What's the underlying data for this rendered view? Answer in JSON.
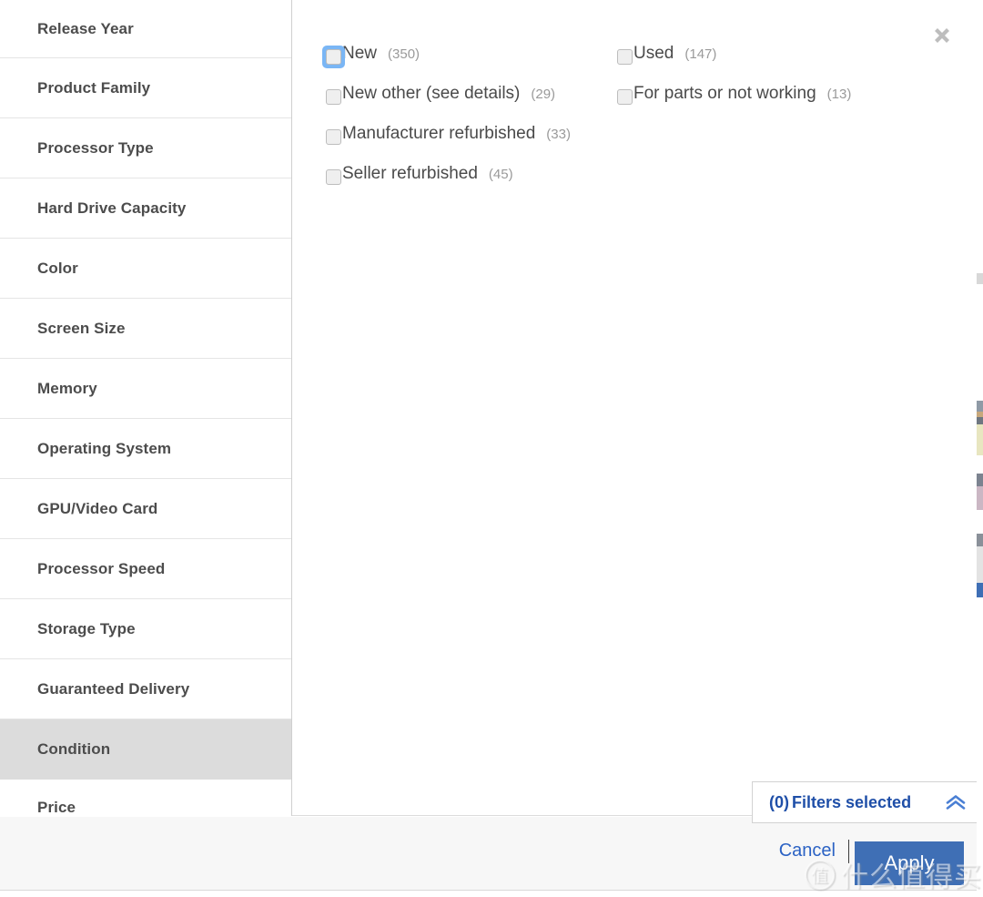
{
  "colors": {
    "accent_blue": "#1f4fa8",
    "link_blue": "#2b62c4",
    "apply_button_bg": "#3f6fb5",
    "focus_ring": "#7ab6f5",
    "selected_row_bg": "#dcdcdc",
    "footer_bg": "#f7f7f7",
    "label_text": "#4c4c4c",
    "count_text": "#9a9a9a"
  },
  "sidebar": {
    "items": [
      {
        "label": "Release Year",
        "selected": false
      },
      {
        "label": "Product Family",
        "selected": false
      },
      {
        "label": "Processor Type",
        "selected": false
      },
      {
        "label": "Hard Drive Capacity",
        "selected": false
      },
      {
        "label": "Color",
        "selected": false
      },
      {
        "label": "Screen Size",
        "selected": false
      },
      {
        "label": "Memory",
        "selected": false
      },
      {
        "label": "Operating System",
        "selected": false
      },
      {
        "label": "GPU/Video Card",
        "selected": false
      },
      {
        "label": "Processor Speed",
        "selected": false
      },
      {
        "label": "Storage Type",
        "selected": false
      },
      {
        "label": "Guaranteed Delivery",
        "selected": false
      },
      {
        "label": "Condition",
        "selected": true
      },
      {
        "label": "Price",
        "selected": false
      }
    ]
  },
  "content": {
    "close_icon": "close-icon",
    "active_aspect": "Condition",
    "options_left": [
      {
        "label": "New",
        "count": "(350)",
        "checked": false,
        "focused": true
      },
      {
        "label": "New other (see details)",
        "count": "(29)",
        "checked": false,
        "focused": false
      },
      {
        "label": "Manufacturer refurbished",
        "count": "(33)",
        "checked": false,
        "focused": false
      },
      {
        "label": "Seller refurbished",
        "count": "(45)",
        "checked": false,
        "focused": false
      }
    ],
    "options_right": [
      {
        "label": "Used",
        "count": "(147)",
        "checked": false,
        "focused": false
      },
      {
        "label": "For parts or not working",
        "count": "(13)",
        "checked": false,
        "focused": false
      }
    ]
  },
  "filters_panel": {
    "count": "(0)",
    "text": "Filters selected",
    "collapse_icon": "double-chevron-up-icon"
  },
  "footer": {
    "cancel_label": "Cancel",
    "apply_label": "Apply"
  },
  "watermark": {
    "badge": "值",
    "text": "什么值得买"
  }
}
